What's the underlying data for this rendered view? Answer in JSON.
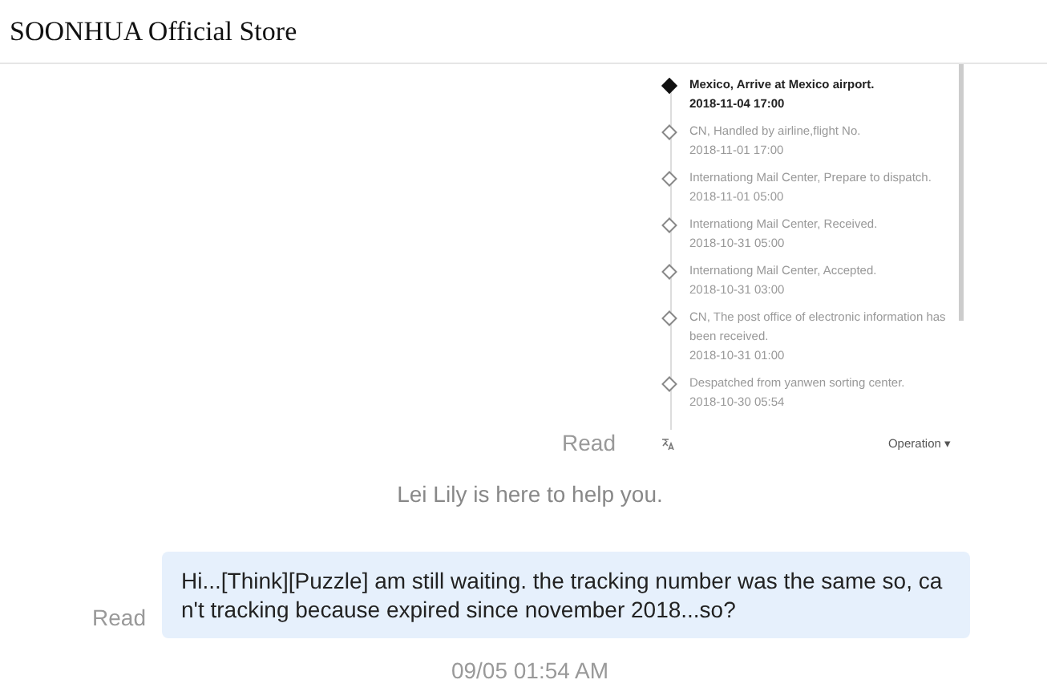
{
  "header": {
    "title": "SOONHUA Official Store"
  },
  "messages": [
    {
      "kind": "image",
      "status": "Read",
      "tracking": [
        {
          "event": "Mexico, Arrive at Mexico airport.",
          "time": "2018-11-04 17:00",
          "current": true
        },
        {
          "event": "CN, Handled by airline,flight No.",
          "time": "2018-11-01 17:00",
          "current": false
        },
        {
          "event": "Internationg Mail Center, Prepare to dispatch.",
          "time": "2018-11-01 05:00",
          "current": false
        },
        {
          "event": "Internationg Mail Center, Received.",
          "time": "2018-10-31 05:00",
          "current": false
        },
        {
          "event": "Internationg Mail Center, Accepted.",
          "time": "2018-10-31 03:00",
          "current": false
        },
        {
          "event": "CN, The post office of electronic information has been received.",
          "time": "2018-10-31 01:00",
          "current": false
        },
        {
          "event": "Despatched from yanwen sorting center.",
          "time": "2018-10-30 05:54",
          "current": false
        }
      ],
      "operation": "Operation ▾"
    },
    {
      "kind": "system",
      "text": "Lei Lily is here to help you."
    },
    {
      "kind": "text",
      "status": "Read",
      "text": "Hi...[Think][Puzzle] am still waiting. the tracking number was the same so, can't tracking because expired since november 2018...so?"
    },
    {
      "kind": "time",
      "text": "09/05 01:54 AM"
    }
  ]
}
